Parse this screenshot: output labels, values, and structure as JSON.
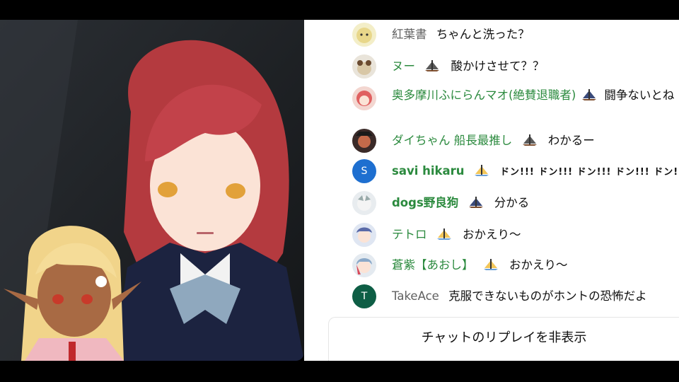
{
  "colors": {
    "chat_background": "#ffffff",
    "member_name": "#2b8a3e",
    "viewer_name": "#616161",
    "avatar_savi": "#1e6fd0",
    "avatar_takeace": "#0e5e45"
  },
  "chat": {
    "messages": [
      {
        "author": "紅葉書",
        "badge": "",
        "text": "ちゃんと洗った？",
        "avatar": "avatar-kouyousho"
      },
      {
        "author": "ヌー",
        "badge": "member-ship-badge",
        "text": "酸かけさせて？？",
        "avatar": "avatar-nu"
      },
      {
        "author": "奥多摩川ふにらんマオ(絶賛退職者)",
        "badge": "member-ship-badge",
        "text": "闘争ないとね",
        "avatar": "avatar-okutama"
      },
      {
        "author": "ダイちゃん 船長最推し",
        "badge": "member-ship-badge",
        "text": "わかるー",
        "avatar": "avatar-daichan"
      },
      {
        "author": "savi hikaru",
        "badge": "member-ship-badge",
        "text": "ドン!!! ドン!!! ドン!!! ドン!!! ドン!!! ドン!!!",
        "avatar": "S"
      },
      {
        "author": "dogs野良狗",
        "badge": "member-ship-badge",
        "text": "分かる",
        "avatar": "avatar-dogs"
      },
      {
        "author": "テトロ",
        "badge": "member-ship-badge",
        "text": "おかえり～",
        "avatar": "avatar-tetoro"
      },
      {
        "author": "蒼紫【あおし】",
        "badge": "member-ship-badge",
        "text": "おかえり～",
        "avatar": "avatar-aoshi"
      },
      {
        "author": "TakeAce",
        "badge": "",
        "text": "克服できないものがホントの恐怖だよ",
        "avatar": "T"
      }
    ],
    "hide_replay_label": "チャットのリプレイを非表示"
  }
}
